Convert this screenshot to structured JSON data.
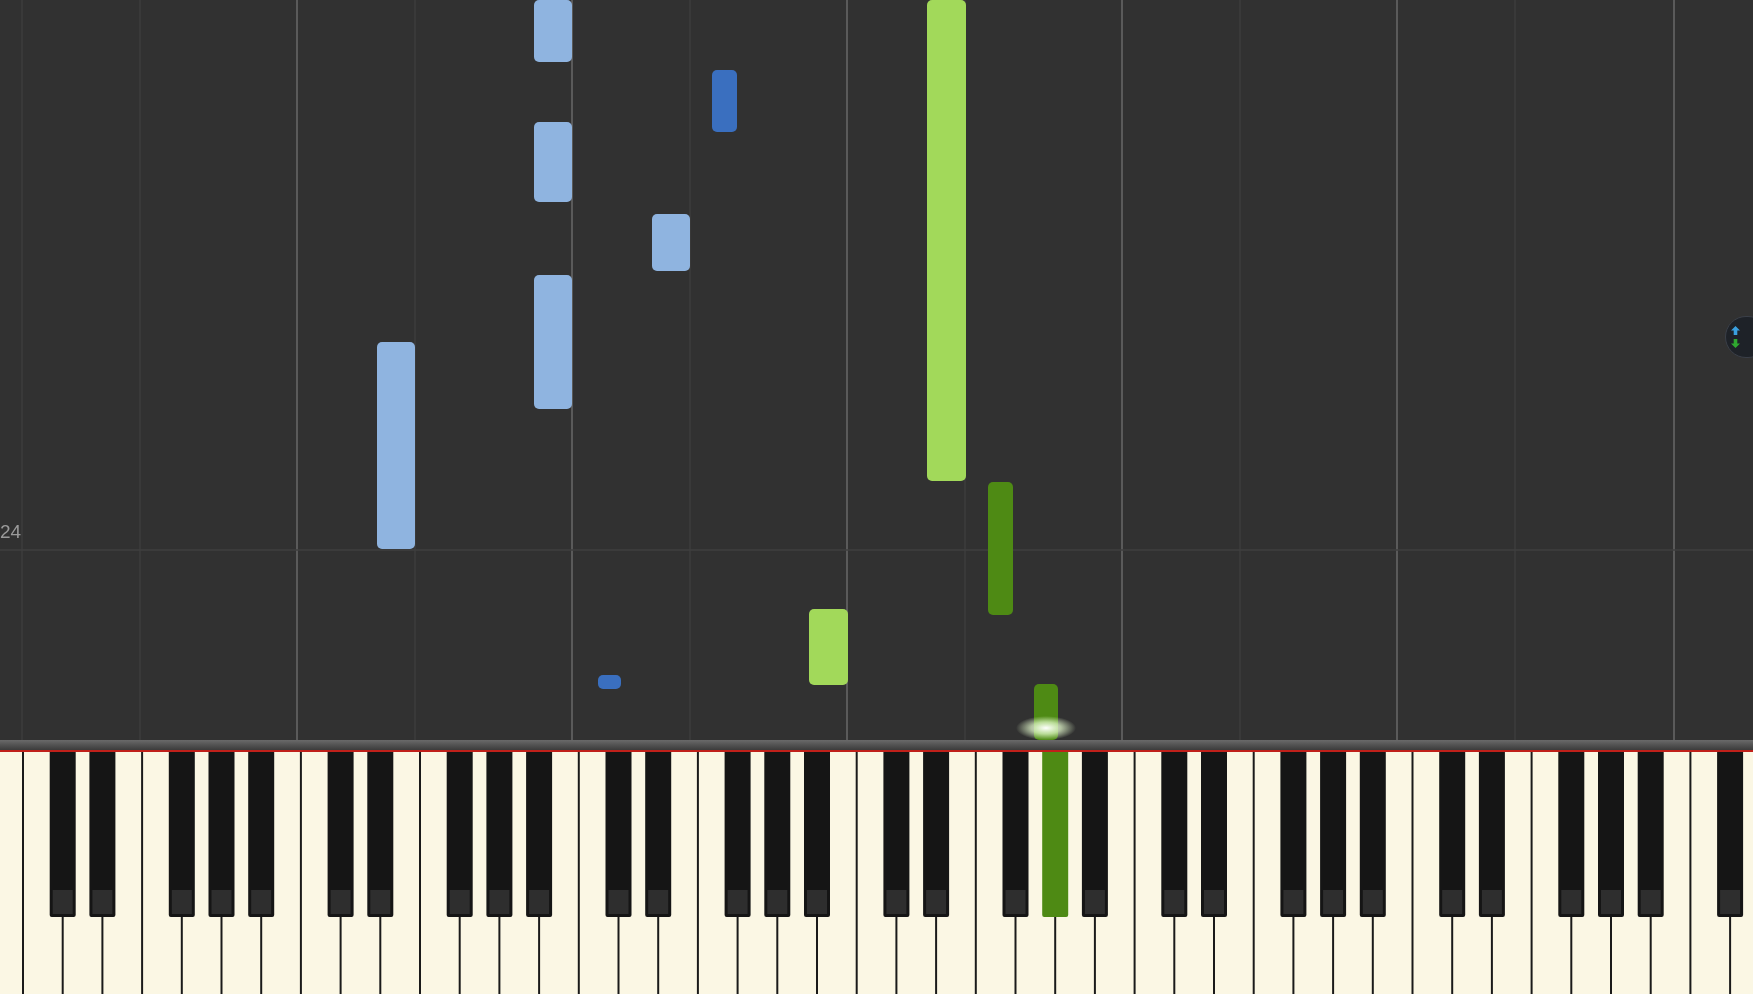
{
  "measure_label": "24",
  "notes": [
    {
      "color": "#8fb4e0"
    },
    {
      "color": "#8fb4e0"
    },
    {
      "color": "#8fb4e0"
    },
    {
      "color": "#8fb4e0"
    },
    {
      "color": "#8fb4e0"
    },
    {
      "color": "#3a6fbf"
    },
    {
      "color": "#3a6fbf"
    },
    {
      "color": "#a2d95a"
    },
    {
      "color": "#a2d95a"
    },
    {
      "color": "#4e8a14"
    }
  ],
  "sounding_note": {
    "color": "#4e8a14"
  }
}
